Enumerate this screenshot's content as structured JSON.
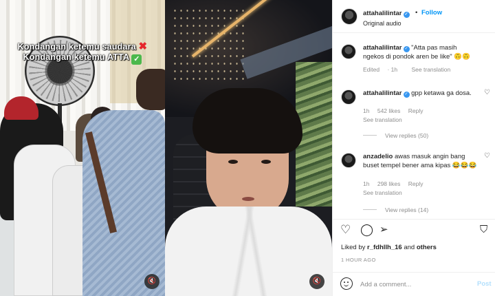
{
  "left_media": {
    "caption_line1": "Kondangan ketemu saudara",
    "caption_line1_emoji": "✖",
    "caption_line2": "Kondangan ketemu ATTA",
    "caption_line2_emoji": "✓",
    "mute_icon": "speaker-muted-icon"
  },
  "right_media": {
    "mute_icon": "speaker-muted-icon"
  },
  "header": {
    "username": "attahalilintar",
    "separator": "•",
    "follow_label": "Follow",
    "subtitle": "Original audio"
  },
  "comments": [
    {
      "username": "attahalilintar",
      "text": "\"Atta pas masih ngekos di pondok aren be like\" 🙃🙃",
      "edited": "Edited",
      "time": "1h",
      "see_translation": "See translation"
    },
    {
      "username": "attahalilintar",
      "text": "gpp ketawa ga dosa.",
      "time": "1h",
      "likes": "542 likes",
      "reply": "Reply",
      "see_translation": "See translation",
      "view_replies": "View replies (50)"
    },
    {
      "username": "anzadelio",
      "text": "awas masuk angin bang buset tempel bener ama kipas 😂😂😂",
      "time": "1h",
      "likes": "298 likes",
      "reply": "Reply",
      "see_translation": "See translation",
      "view_replies": "View replies (14)"
    }
  ],
  "footer": {
    "liked_by_prefix": "Liked by",
    "liked_by_user": "r_fdhllh_16",
    "liked_by_and": "and",
    "liked_by_others": "others",
    "time_ago": "1 HOUR AGO",
    "comment_placeholder": "Add a comment...",
    "post_label": "Post"
  },
  "colors": {
    "accent": "#0095f6",
    "verified": "#3897f0",
    "post_disabled": "#b2dffc",
    "muted_text": "#8e8e8e"
  }
}
